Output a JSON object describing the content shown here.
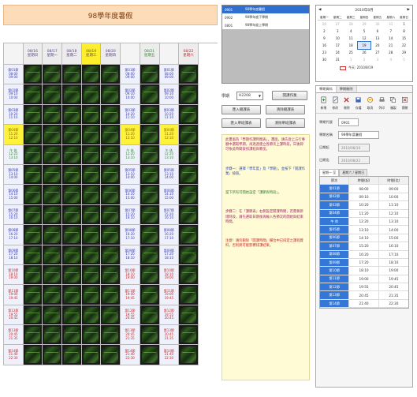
{
  "left": {
    "title": "98學年度暑假",
    "header_days": [
      {
        "date": "",
        "dow": "",
        "cls": "corner"
      },
      {
        "date": "08/16",
        "dow": "星期日",
        "cls": ""
      },
      {
        "date": "08/17",
        "dow": "星期一",
        "cls": ""
      },
      {
        "date": "08/18",
        "dow": "星期二",
        "cls": ""
      },
      {
        "date": "08/19",
        "dow": "星期三",
        "cls": "today"
      },
      {
        "date": "08/20",
        "dow": "星期四",
        "cls": ""
      },
      {
        "date": "",
        "dow": "",
        "cls": "corner"
      },
      {
        "date": "08/21",
        "dow": "星期五",
        "cls": "green"
      },
      {
        "date": "",
        "dow": "",
        "cls": "corner"
      },
      {
        "date": "08/22",
        "dow": "星期六",
        "cls": "red"
      }
    ],
    "rows": [
      {
        "period": "第01節",
        "t1": "08:00",
        "t2": "09:00",
        "cls": ""
      },
      {
        "period": "第02節",
        "t1": "09:10",
        "t2": "10:00",
        "cls": ""
      },
      {
        "period": "第03節",
        "t1": "10:20",
        "t2": "11:10",
        "cls": ""
      },
      {
        "period": "第04節",
        "t1": "11:20",
        "t2": "12:10",
        "cls": "hl"
      },
      {
        "period": "午 休",
        "t1": "12:20",
        "t2": "13:10",
        "cls": "green"
      },
      {
        "period": "第05節",
        "t1": "13:10",
        "t2": "14:00",
        "cls": ""
      },
      {
        "period": "第06節",
        "t1": "14:10",
        "t2": "15:00",
        "cls": ""
      },
      {
        "period": "第07節",
        "t1": "15:20",
        "t2": "16:10",
        "cls": ""
      },
      {
        "period": "第08節",
        "t1": "16:20",
        "t2": "17:10",
        "cls": ""
      },
      {
        "period": "第09節",
        "t1": "17:20",
        "t2": "18:10",
        "cls": ""
      },
      {
        "period": "第10節",
        "t1": "18:10",
        "t2": "19:00",
        "cls": "red"
      },
      {
        "period": "第11節",
        "t1": "19:00",
        "t2": "19:45",
        "cls": "red"
      },
      {
        "period": "第12節",
        "t1": "19:55",
        "t2": "20:45",
        "cls": "red"
      },
      {
        "period": "第13節",
        "t1": "20:45",
        "t2": "21:35",
        "cls": "red"
      },
      {
        "period": "第14節",
        "t1": "21:40",
        "t2": "22:30",
        "cls": "red"
      }
    ],
    "time_columns": [
      0,
      6,
      8
    ]
  },
  "mid": {
    "list": [
      {
        "code": "0901",
        "name": "98學年度暑假",
        "selected": true
      },
      {
        "code": "0902",
        "name": "98學年度下學期",
        "selected": false
      },
      {
        "code": "0801",
        "name": "98學年度上學期",
        "selected": false
      }
    ],
    "semester_label": "學期",
    "semester_value": "H2208",
    "buttons": {
      "new_schedule": "開課作業",
      "import_class": "匯入總課表",
      "clear_class": "清除總課表",
      "import_single": "匯入單班課表",
      "clear_single": "清除單班課表"
    },
    "info": [
      {
        "cls": "",
        "text": "此畫面為「學期作課時間表」。畫面，請先從上方行事曆中選取學期，再逐週建立各節次上課時段，日後即可依此時間安排課程與教室。"
      },
      {
        "cls": "blue",
        "text": "步驟一：選擇「學年度」及「學期」，並按下「開課作業」按鈕。"
      },
      {
        "cls": "green",
        "text": "當下所有可開始設定「課節與時段」。"
      },
      {
        "cls": "",
        "text": "步驟二：在「課節表」右側設定開課時間，若需要新增時段，請先選取日期後再輸入各節次的開始與結束時間。"
      },
      {
        "cls": "red",
        "text": "注意！請勿刪除「開課時間」欄位中已排定之課程資料，否則將可能影響排課結果。"
      }
    ]
  },
  "right": {
    "calendar": {
      "title": "2010年8月",
      "dow": [
        "星期一",
        "星期二",
        "星期三",
        "星期四",
        "星期五",
        "星期六",
        "星期日"
      ],
      "days": [
        {
          "d": "26",
          "o": true
        },
        {
          "d": "27",
          "o": true
        },
        {
          "d": "28",
          "o": true
        },
        {
          "d": "29",
          "o": true
        },
        {
          "d": "30",
          "o": true
        },
        {
          "d": "31",
          "o": true
        },
        {
          "d": "1",
          "o": false
        },
        {
          "d": "2",
          "o": false
        },
        {
          "d": "3",
          "o": false
        },
        {
          "d": "4",
          "o": false
        },
        {
          "d": "5",
          "o": false
        },
        {
          "d": "6",
          "o": false
        },
        {
          "d": "7",
          "o": false
        },
        {
          "d": "8",
          "o": false
        },
        {
          "d": "9",
          "o": false
        },
        {
          "d": "10",
          "o": false
        },
        {
          "d": "11",
          "o": false
        },
        {
          "d": "12",
          "o": false
        },
        {
          "d": "13",
          "o": false
        },
        {
          "d": "14",
          "o": false
        },
        {
          "d": "15",
          "o": false
        },
        {
          "d": "16",
          "o": false
        },
        {
          "d": "17",
          "o": false
        },
        {
          "d": "18",
          "o": false
        },
        {
          "d": "19",
          "o": false,
          "t": true
        },
        {
          "d": "20",
          "o": false
        },
        {
          "d": "21",
          "o": false
        },
        {
          "d": "22",
          "o": false
        },
        {
          "d": "23",
          "o": false
        },
        {
          "d": "24",
          "o": false
        },
        {
          "d": "25",
          "o": false
        },
        {
          "d": "26",
          "o": false
        },
        {
          "d": "27",
          "o": false
        },
        {
          "d": "28",
          "o": false
        },
        {
          "d": "29",
          "o": false
        },
        {
          "d": "30",
          "o": false
        },
        {
          "d": "31",
          "o": false
        },
        {
          "d": "1",
          "o": true
        },
        {
          "d": "2",
          "o": true
        },
        {
          "d": "3",
          "o": true
        },
        {
          "d": "4",
          "o": true
        },
        {
          "d": "5",
          "o": true
        }
      ],
      "today_label": "今天: 2010/8/19"
    },
    "tabs": [
      "學期資料",
      "學期刪除"
    ],
    "tools": [
      {
        "icon": "new-icon",
        "label": "新增"
      },
      {
        "icon": "edit-icon",
        "label": "修改"
      },
      {
        "icon": "delete-icon",
        "label": "刪除"
      },
      {
        "icon": "save-icon",
        "label": "存檔"
      },
      {
        "icon": "cancel-icon",
        "label": "取消"
      },
      {
        "icon": "print-icon",
        "label": "列印"
      },
      {
        "icon": "copy-icon",
        "label": "複製"
      },
      {
        "icon": "close-icon",
        "label": "關閉"
      }
    ],
    "form": {
      "code_label": "學期代號",
      "code_value": "0901",
      "name_label": "學期名稱",
      "name_value": "98學年度暑假",
      "start_label": "日期起",
      "start_value": "2010/08/16",
      "end_label": "日期迄",
      "end_value": "2010/08/22"
    },
    "subtabs": [
      "星期一 至",
      "星期六 / 星期日"
    ],
    "table": {
      "headers": [
        "節次",
        "時間(起)",
        "時間(迄)"
      ],
      "rows": [
        [
          "第01節",
          "08:00",
          "09:00"
        ],
        [
          "第02節",
          "09:10",
          "10:00"
        ],
        [
          "第03節",
          "10:20",
          "11:10"
        ],
        [
          "第04節",
          "11:20",
          "12:10"
        ],
        [
          "午 休",
          "12:20",
          "13:10"
        ],
        [
          "第05節",
          "13:10",
          "14:00"
        ],
        [
          "第06節",
          "14:10",
          "15:00"
        ],
        [
          "第07節",
          "15:20",
          "16:10"
        ],
        [
          "第08節",
          "16:20",
          "17:10"
        ],
        [
          "第09節",
          "17:20",
          "18:10"
        ],
        [
          "第10節",
          "18:10",
          "19:00"
        ],
        [
          "第11節",
          "19:00",
          "19:45"
        ],
        [
          "第12節",
          "19:55",
          "20:45"
        ],
        [
          "第13節",
          "20:45",
          "21:35"
        ],
        [
          "第14節",
          "21:40",
          "22:30"
        ]
      ]
    }
  }
}
